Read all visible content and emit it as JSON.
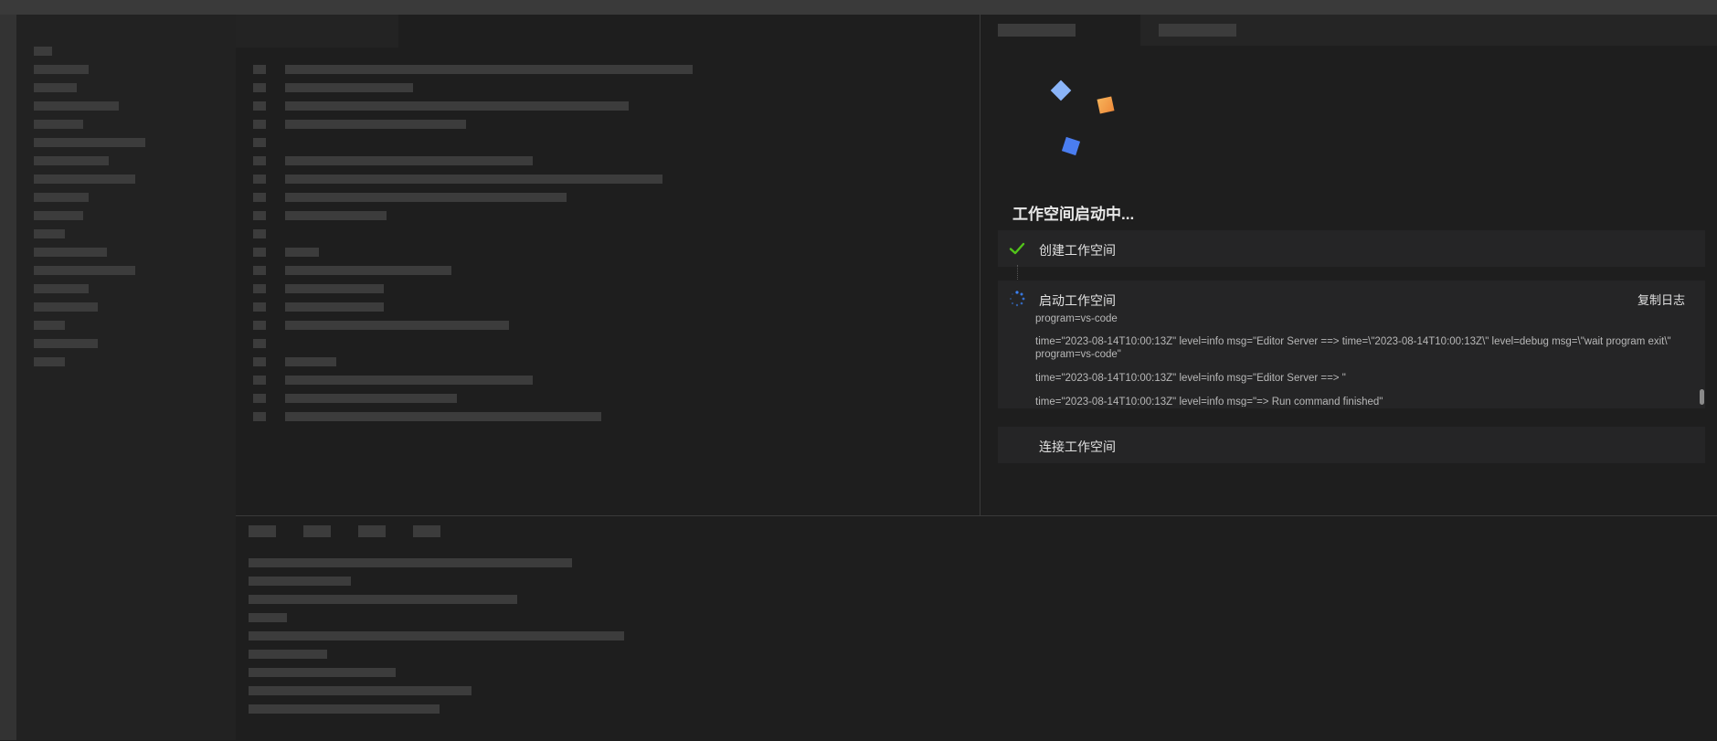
{
  "workspace": {
    "title": "工作空间启动中...",
    "steps": [
      {
        "label": "创建工作空间",
        "status": "done",
        "icon": "check-icon"
      },
      {
        "label": "启动工作空间",
        "status": "in-progress",
        "icon": "spinner-icon",
        "action_label": "复制日志"
      },
      {
        "label": "连接工作空间",
        "status": "pending"
      }
    ],
    "logs": [
      "program=vs-code",
      "time=\"2023-08-14T10:00:13Z\" level=info msg=\"Editor Server ==> time=\\\"2023-08-14T10:00:13Z\\\" level=debug msg=\\\"wait program exit\\\" program=vs-code\"",
      "time=\"2023-08-14T10:00:13Z\" level=info msg=\"Editor Server ==> \"",
      "time=\"2023-08-14T10:00:13Z\" level=info msg=\"=> Run command finished\""
    ]
  },
  "colors": {
    "check": "#52c41a",
    "spinner": "#3b82f6",
    "logo_diamond": "#8ab4f8",
    "logo_orange": "#f5a44a",
    "logo_blue": "#4a7df0"
  }
}
